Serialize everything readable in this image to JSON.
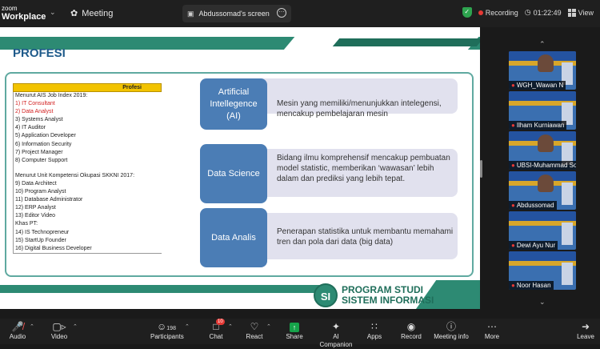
{
  "window": {
    "brand_line1": "zoom",
    "brand_line2": "Workplace",
    "meeting_label": "Meeting",
    "share_tab": "Abdussomad's screen",
    "recording_label": "Recording",
    "timer": "01:22:49",
    "view_label": "View"
  },
  "slide": {
    "title": "PROFESI",
    "table": {
      "header": "Profesi",
      "group1_title": "Menurut AIS Job Index 2019:",
      "group1": [
        {
          "text": "1) IT Consultant",
          "red": true
        },
        {
          "text": "2) Data Analyst",
          "red": true
        },
        {
          "text": "3) Systems Analyst",
          "red": false
        },
        {
          "text": "4) IT Auditor",
          "red": false
        },
        {
          "text": "5) Application Developer",
          "red": false
        },
        {
          "text": "6) Information Security",
          "red": false
        },
        {
          "text": "7) Project Manager",
          "red": false
        },
        {
          "text": "8) Computer Support",
          "red": false
        }
      ],
      "group2_title": "Menurut Unit Kompetensi Okupasi SKKNI 2017:",
      "group2": [
        "9) Data Architect",
        "10) Program Analyst",
        "11) Database Administrator",
        "12) ERP Analyst",
        "13) Editor Video"
      ],
      "group3_title": "Khas PT:",
      "group3": [
        "14) IS Technopreneur",
        "15) StartUp Founder",
        "16) Digital Business Developer"
      ]
    },
    "cards": [
      {
        "badge": "Artificial\nIntellegence\n(AI)",
        "text": "Mesin yang memiliki/menunjukkan intelegensi, mencakup pembelajaran mesin"
      },
      {
        "badge": "Data Science",
        "text": "Bidang ilmu komprehensif mencakup pembuatan model statistic, memberikan ‘wawasan’ lebih dalam dan prediksi yang lebih tepat."
      },
      {
        "badge": "Data Analis",
        "text": "Penerapan statistika untuk membantu memahami tren dan pola dari data (big data)"
      }
    ],
    "logo_mark": "SI",
    "logo_line1": "PROGRAM STUDI",
    "logo_line2": "SISTEM INFORMASI"
  },
  "gallery": [
    "WGH_Wawan N",
    "Ilham Kurniawan",
    "UBSI-Muhammad So...",
    "Abdussomad",
    "Dewi Ayu Nur",
    "Noor Hasan"
  ],
  "toolbar": {
    "audio": "Audio",
    "video": "Video",
    "participants": "Participants",
    "participants_count": "198",
    "chat": "Chat",
    "chat_badge": "10",
    "react": "React",
    "share": "Share",
    "ai_companion": "AI Companion",
    "apps": "Apps",
    "record": "Record",
    "meeting_info": "Meeting info",
    "more": "More",
    "leave": "Leave"
  }
}
